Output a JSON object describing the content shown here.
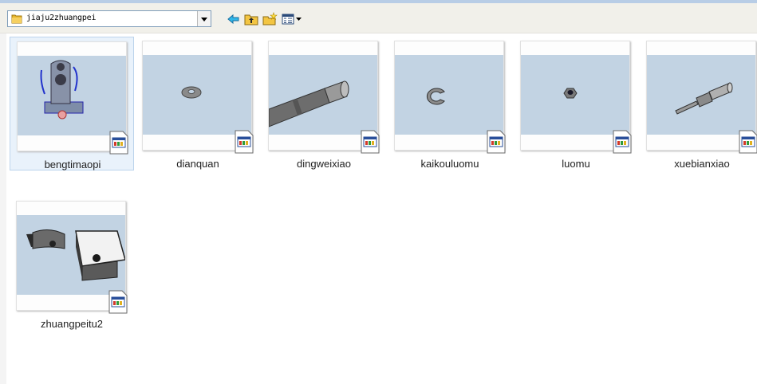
{
  "toolbar": {
    "path": "jiaju2zhuangpei",
    "icons": [
      "back-icon",
      "up-folder-icon",
      "new-folder-icon",
      "view-menu-icon"
    ]
  },
  "files": [
    {
      "name": "bengtimaopi",
      "selected": true
    },
    {
      "name": "dianquan"
    },
    {
      "name": "dingweixiao"
    },
    {
      "name": "kaikouluomu"
    },
    {
      "name": "luomu"
    },
    {
      "name": "xuebianxiao"
    },
    {
      "name": "zhuangpeitu2"
    }
  ],
  "colors": {
    "thumb_bg": "#c2d3e3",
    "selected_bg": "#e9f2fb",
    "toolbar_bg": "#f1f0ea"
  }
}
